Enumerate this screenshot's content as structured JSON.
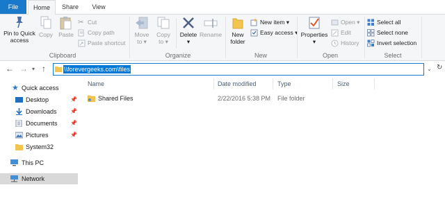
{
  "ribbon_tabs": [
    "File",
    "Home",
    "Share",
    "View"
  ],
  "clipboard": {
    "pin_label_1": "Pin to Quick",
    "pin_label_2": "access",
    "copy_label": "Copy",
    "paste_label": "Paste",
    "cut_label": "Cut",
    "copy_path_label": "Copy path",
    "paste_shortcut_label": "Paste shortcut",
    "group_label": "Clipboard"
  },
  "organize": {
    "move_label": "Move",
    "move_to_label": "to",
    "copy_label": "Copy",
    "copy_to_label": "to",
    "delete_label": "Delete",
    "rename_label": "Rename",
    "group_label": "Organize"
  },
  "new": {
    "new_folder_1": "New",
    "new_folder_2": "folder",
    "new_item_label": "New item",
    "easy_access_label": "Easy access",
    "group_label": "New"
  },
  "open": {
    "properties_label": "Properties",
    "open_label": "Open",
    "edit_label": "Edit",
    "history_label": "History",
    "group_label": "Open"
  },
  "select": {
    "select_all_label": "Select all",
    "select_none_label": "Select none",
    "invert_label": "Invert selection",
    "group_label": "Select"
  },
  "address": {
    "path": "\\\\forevergeeks.com\\files"
  },
  "nav": {
    "quick_access": "Quick access",
    "desktop": "Desktop",
    "downloads": "Downloads",
    "documents": "Documents",
    "pictures": "Pictures",
    "system32": "System32",
    "this_pc": "This PC",
    "network": "Network"
  },
  "columns": {
    "name": "Name",
    "date_modified": "Date modified",
    "type": "Type",
    "size": "Size"
  },
  "files": [
    {
      "name": "Shared Files",
      "date_modified": "2/22/2016 5:38 PM",
      "type": "File folder",
      "size": ""
    }
  ],
  "colors": {
    "accent": "#1979ca",
    "selection": "#0078d7",
    "folder": "#f3c44f",
    "header_text": "#4c607a"
  }
}
